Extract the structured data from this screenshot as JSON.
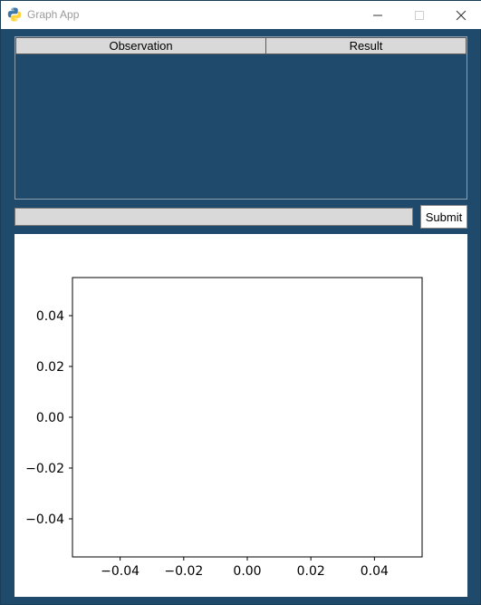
{
  "window": {
    "title": "Graph App",
    "icon": "python-icon"
  },
  "table": {
    "columns": [
      "Observation",
      "Result"
    ],
    "rows": []
  },
  "input": {
    "value": "",
    "placeholder": ""
  },
  "submit_label": "Submit",
  "chart_data": {
    "type": "scatter",
    "title": "",
    "xlabel": "",
    "ylabel": "",
    "x": [],
    "y": [],
    "xlim": [
      -0.055,
      0.055
    ],
    "ylim": [
      -0.055,
      0.055
    ],
    "xticks": [
      "−0.04",
      "−0.02",
      "0.00",
      "0.02",
      "0.04"
    ],
    "yticks": [
      "0.04",
      "0.02",
      "0.00",
      "−0.02",
      "−0.04"
    ],
    "grid": false
  }
}
